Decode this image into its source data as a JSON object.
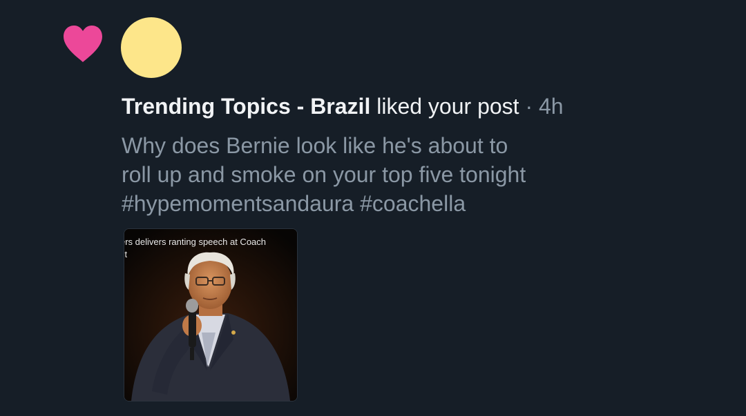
{
  "notification": {
    "actor": "Trending Topics - Brazil",
    "action": " liked your post",
    "separator": " · ",
    "time": "4h",
    "post_lines": [
      "Why does Bernie look like he's about to",
      "roll up and smoke on your top five tonight",
      "#hypemomentsandaura #coachella"
    ],
    "media": {
      "caption_lines": [
        "ers delivers ranting speech at Coach",
        "st"
      ]
    }
  },
  "colors": {
    "background": "#161e27",
    "heart": "#ec4899",
    "avatar": "#fde68a",
    "primary_text": "#f1f3f5",
    "secondary_text": "#8b98a5"
  },
  "icons": {
    "type": "heart-icon"
  }
}
